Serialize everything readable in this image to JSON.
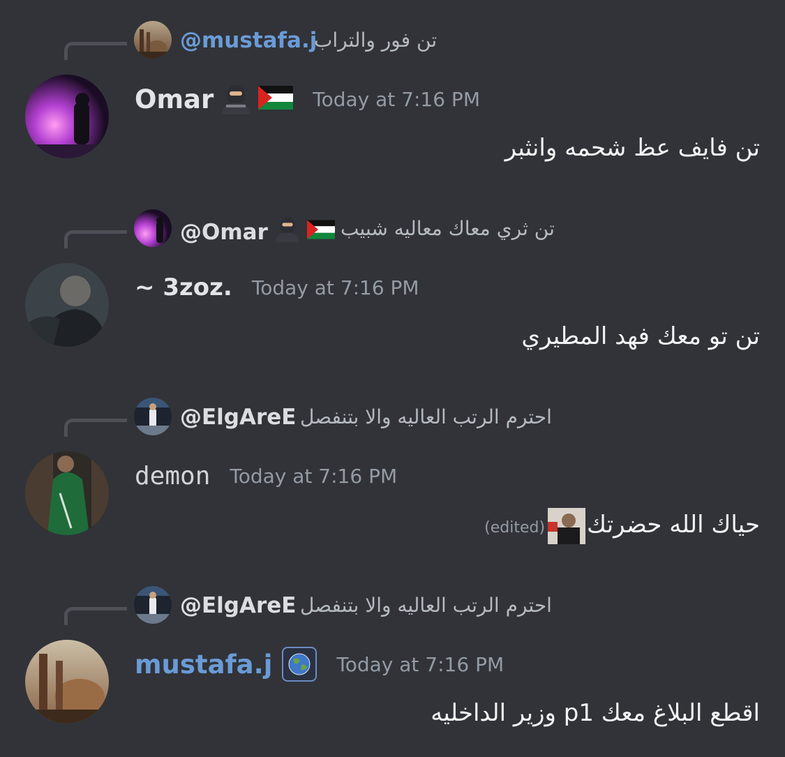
{
  "messages": [
    {
      "reply": {
        "name": "@mustafa.j",
        "text": "تن فور والتراب"
      },
      "author": "Omar",
      "timestamp": "Today at 7:16 PM",
      "content": "تن فايف عظ شحمه وانثبر"
    },
    {
      "reply": {
        "name": "@Omar",
        "text": "تن ثري معاك معاليه شبيب"
      },
      "author": "~ 3zoz.",
      "timestamp": "Today at 7:16 PM",
      "content": "تن تو معك فهد المطيري"
    },
    {
      "reply": {
        "name": "@ElgAreE",
        "text": "احترم الرتب العاليه والا بتنفصل"
      },
      "author": "demon",
      "timestamp": "Today at 7:16 PM",
      "content": "حياك الله حضرتك",
      "edited": "(edited)"
    },
    {
      "reply": {
        "name": "@ElgAreE",
        "text": "احترم الرتب العاليه والا بتنفصل"
      },
      "author": "mustafa.j",
      "timestamp": "Today at 7:16 PM",
      "content": "اقطع البلاغ معك p1 وزير الداخليه"
    }
  ],
  "colors": {
    "background": "#313338",
    "author_blue": "#6a9bd6",
    "timestamp": "#949ba4",
    "reply_line": "#4e5058"
  },
  "icons": [
    "ninja-emoji",
    "palestine-flag-emoji",
    "earth-globe-emoji",
    "sticker-image"
  ]
}
